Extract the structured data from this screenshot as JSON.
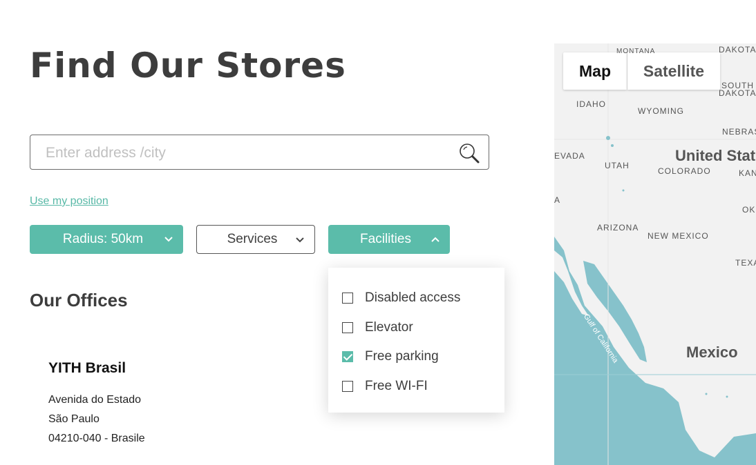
{
  "page": {
    "title": "Find Our Stores"
  },
  "search": {
    "placeholder": "Enter address /city",
    "value": "",
    "icon": "search-icon"
  },
  "use_position_label": "Use my position",
  "filters": {
    "radius_label": "Radius: 50km",
    "services_label": "Services",
    "facilities_label": "Facilities"
  },
  "facilities_dropdown": {
    "options": [
      {
        "label": "Disabled access",
        "checked": false
      },
      {
        "label": "Elevator",
        "checked": false
      },
      {
        "label": "Free parking",
        "checked": true
      },
      {
        "label": "Free WI-FI",
        "checked": false
      }
    ]
  },
  "offices": {
    "title": "Our Offices",
    "store": {
      "name": "YITH Brasil",
      "address_line1": "Avenida do Estado",
      "address_line2": "São Paulo",
      "address_line3": "04210-040 - Brasile"
    }
  },
  "map": {
    "tabs": {
      "map": "Map",
      "satellite": "Satellite"
    },
    "labels": {
      "montana": "MONTANA",
      "north_dakota": "DAKOTA",
      "south_dakota_1": "SOUTH",
      "south_dakota_2": "DAKOTA",
      "idaho": "IDAHO",
      "wyoming": "WYOMING",
      "nebraska": "NEBRAS",
      "nevada": "EVADA",
      "utah": "UTAH",
      "united_states": "United Stat",
      "colorado": "COLORADO",
      "kansas": "KAN",
      "arizona_left": "A",
      "oklahoma": "OK",
      "arizona": "ARIZONA",
      "new_mexico": "NEW MEXICO",
      "texas": "TEXA",
      "gulf": "Gulf of California",
      "mexico": "Mexico"
    },
    "colors": {
      "land": "#f2f2f2",
      "water": "#86c2cb",
      "accent": "#5bbcaa"
    }
  }
}
